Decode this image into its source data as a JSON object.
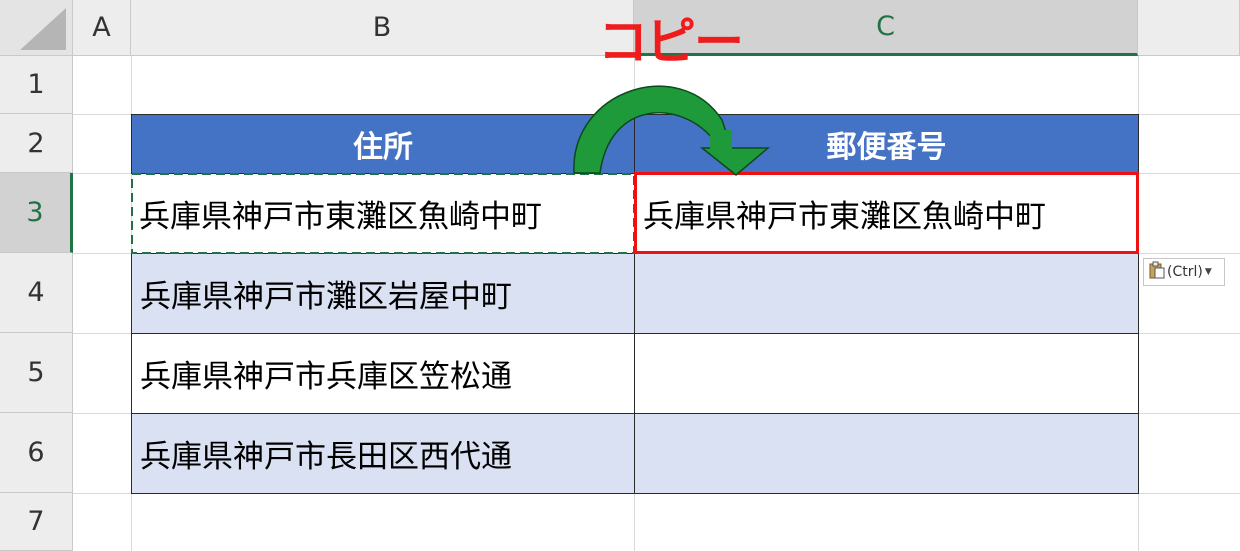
{
  "sheet": {
    "column_headers": [
      "A",
      "B",
      "C"
    ],
    "row_headers": [
      "1",
      "2",
      "3",
      "4",
      "5",
      "6",
      "7"
    ],
    "selected_column": "C",
    "selected_row": "3"
  },
  "table": {
    "headers": [
      "住所",
      "郵便番号"
    ],
    "rows": [
      [
        "兵庫県神戸市東灘区魚崎中町",
        "兵庫県神戸市東灘区魚崎中町"
      ],
      [
        "兵庫県神戸市灘区岩屋中町",
        ""
      ],
      [
        "兵庫県神戸市兵庫区笠松通",
        ""
      ],
      [
        "兵庫県神戸市長田区西代通",
        ""
      ]
    ],
    "header_color": "#4472c4",
    "band_color": "#d9e1f2"
  },
  "annotation": {
    "label": "コピー",
    "label_color": "#ee1c1c",
    "arrow_color": "#1f9a3b"
  },
  "paste_options": {
    "label": "(Ctrl)",
    "icon": "clipboard-icon"
  }
}
